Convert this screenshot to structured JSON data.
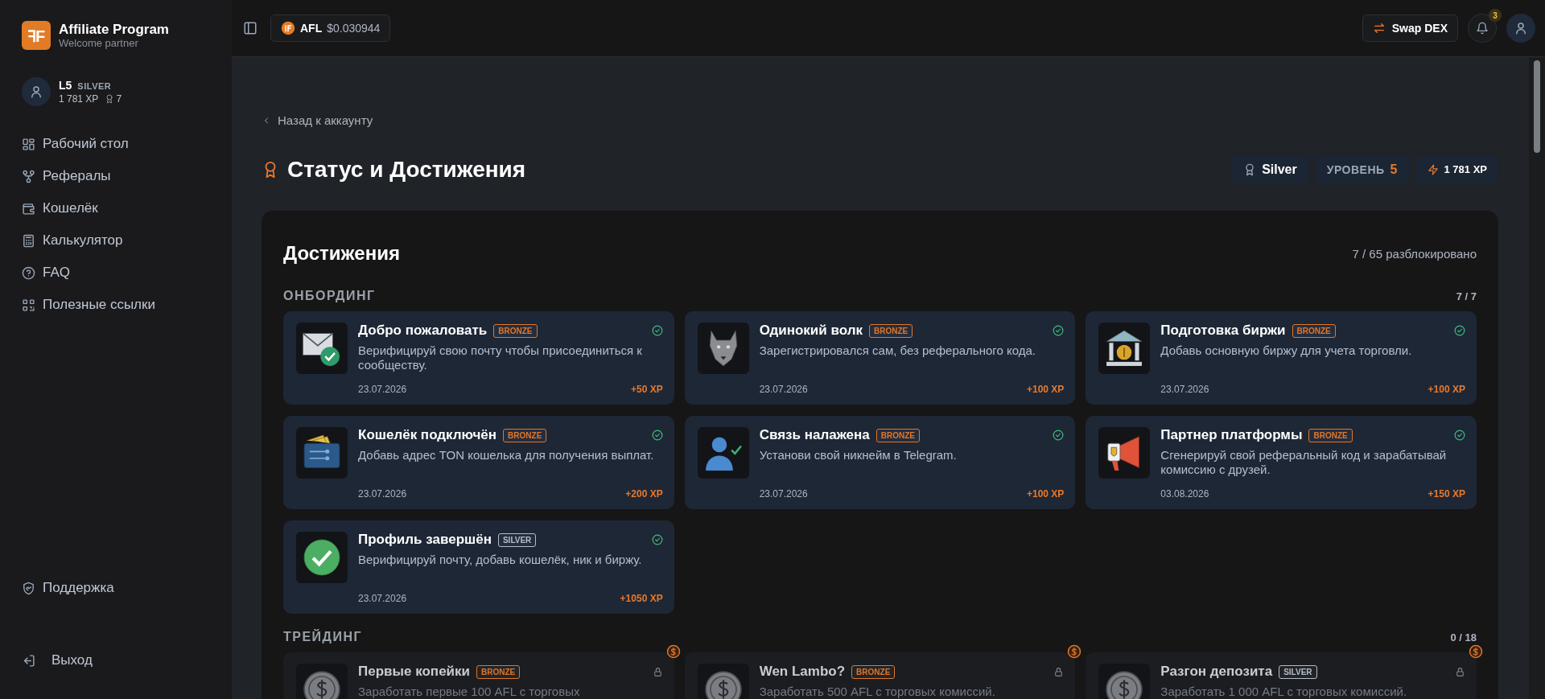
{
  "brand": {
    "logo": "ꟻF",
    "title": "Affiliate Program",
    "subtitle": "Welcome partner"
  },
  "user": {
    "level": "L5",
    "tier": "SILVER",
    "xp": "1 781 XP",
    "badges": "7"
  },
  "nav": [
    {
      "label": "Рабочий стол",
      "selected": false
    },
    {
      "label": "Рефералы",
      "selected": false
    },
    {
      "label": "Кошелёк",
      "selected": false
    },
    {
      "label": "Калькулятор",
      "selected": false
    },
    {
      "label": "FAQ",
      "selected": false
    },
    {
      "label": "Полезные ссылки",
      "selected": false
    }
  ],
  "support": {
    "label": "Поддержка"
  },
  "logout": {
    "label": "Выход"
  },
  "topbar": {
    "token": "AFL",
    "price": "$0.030944",
    "swap": "Swap DEX",
    "notifications": "3"
  },
  "back_link": "Назад к аккаунту",
  "page_title": "Статус и Достижения",
  "status": {
    "tier": "Silver",
    "level_label": "УРОВЕНЬ",
    "level": "5",
    "xp": "1 781 XP"
  },
  "achievements": {
    "title": "Достижения",
    "summary": "7 / 65 разблокировано",
    "sections": [
      {
        "title": "ОНБОРДИНГ",
        "count": "7 / 7",
        "items": [
          {
            "title": "Добро пожаловать",
            "tier": "BRONZE",
            "color": "#e0762a",
            "unlocked": true,
            "description": "Верифицируй свою почту чтобы присоединиться к сообществу.",
            "date": "23.07.2026",
            "xp": "+50 XP"
          },
          {
            "title": "Одинокий волк",
            "tier": "BRONZE",
            "color": "#e0762a",
            "unlocked": true,
            "description": "Зарегистрировался сам, без реферального кода.",
            "date": "23.07.2026",
            "xp": "+100 XP"
          },
          {
            "title": "Подготовка биржи",
            "tier": "BRONZE",
            "color": "#e0762a",
            "unlocked": true,
            "description": "Добавь основную биржу для учета торговли.",
            "date": "23.07.2026",
            "xp": "+100 XP"
          },
          {
            "title": "Кошелёк подключён",
            "tier": "BRONZE",
            "color": "#e0762a",
            "unlocked": true,
            "description": "Добавь адрес TON кошелька для получения выплат.",
            "date": "23.07.2026",
            "xp": "+200 XP"
          },
          {
            "title": "Связь налажена",
            "tier": "BRONZE",
            "color": "#e0762a",
            "unlocked": true,
            "description": "Установи свой никнейм в Telegram.",
            "date": "23.07.2026",
            "xp": "+100 XP"
          },
          {
            "title": "Партнер платформы",
            "tier": "BRONZE",
            "color": "#e0762a",
            "unlocked": true,
            "description": "Сгенерируй свой реферальный код и зарабатывай комиссию с друзей.",
            "date": "03.08.2026",
            "xp": "+150 XP"
          },
          {
            "title": "Профиль завершён",
            "tier": "SILVER",
            "color": "#b4bcc8",
            "unlocked": true,
            "description": "Верифицируй почту, добавь кошелёк, ник и биржу.",
            "date": "23.07.2026",
            "xp": "+1050 XP"
          }
        ]
      },
      {
        "title": "ТРЕЙДИНГ",
        "count": "0 / 18",
        "items": [
          {
            "title": "Первые копейки",
            "tier": "BRONZE",
            "color": "#e0762a",
            "unlocked": false,
            "description": "Заработать первые 100 AFL с торговых"
          },
          {
            "title": "Wen Lambo?",
            "tier": "BRONZE",
            "color": "#e0762a",
            "unlocked": false,
            "description": "Заработать 500 AFL с торговых комиссий."
          },
          {
            "title": "Разгон депозита",
            "tier": "SILVER",
            "color": "#b4bcc8",
            "unlocked": false,
            "description": "Заработать 1 000 AFL с торговых комиссий."
          }
        ]
      }
    ]
  }
}
